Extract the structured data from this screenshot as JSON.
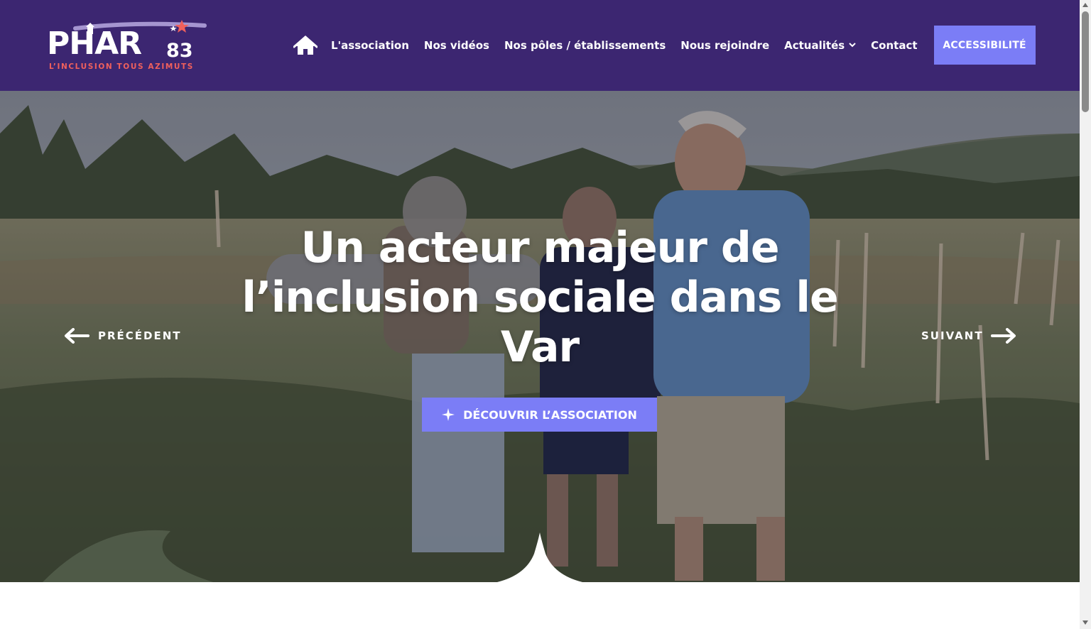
{
  "header": {
    "logo": {
      "name": "PHAR",
      "number": "83",
      "tagline": "L’INCLUSION TOUS AZIMUTS"
    },
    "nav": {
      "home_icon": "home-icon",
      "items": [
        {
          "label": "L'association"
        },
        {
          "label": "Nos vidéos"
        },
        {
          "label": "Nos pôles / établissements"
        },
        {
          "label": "Nous rejoindre"
        },
        {
          "label": "Actualités",
          "has_dropdown": true
        },
        {
          "label": "Contact"
        }
      ],
      "accessibility_label": "ACCESSIBILITÉ"
    },
    "colors": {
      "background": "#3c2671",
      "accent": "#7b7df6",
      "logo_accent": "#f0605c"
    }
  },
  "hero": {
    "title": "Un acteur majeur de l’inclusion sociale dans le Var",
    "cta_label": "DÉCOUVRIR L’ASSOCIATION",
    "cta_icon": "sparkle-icon",
    "prev_label": "PRÉCÉDENT",
    "next_label": "SUIVANT",
    "prev_icon": "arrow-left-icon",
    "next_icon": "arrow-right-icon"
  }
}
